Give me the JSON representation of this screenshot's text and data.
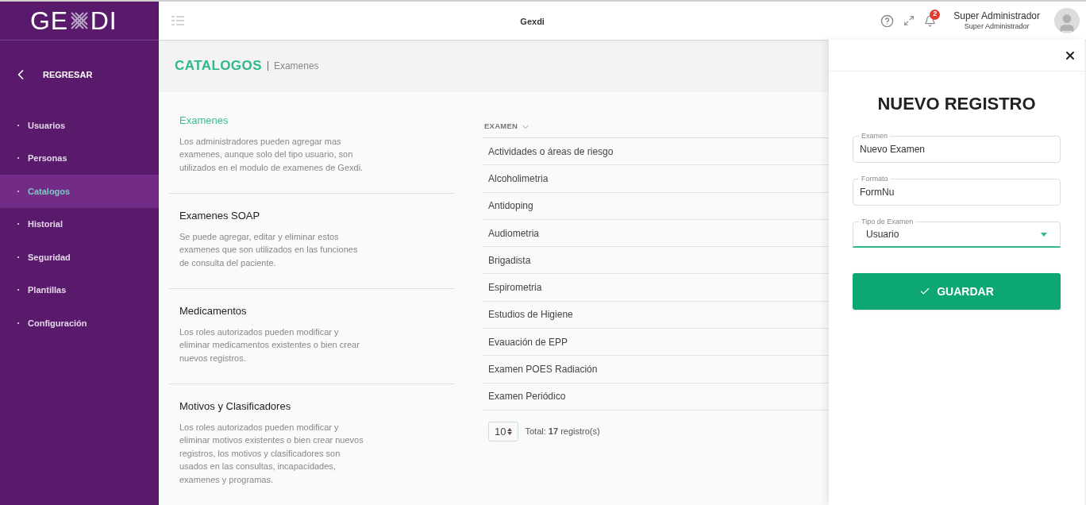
{
  "logo": {
    "left": "GE",
    "right": "DI"
  },
  "sidebar": {
    "back": "REGRESAR",
    "items": [
      {
        "label": "Usuarios",
        "selected": false
      },
      {
        "label": "Personas",
        "selected": false
      },
      {
        "label": "Catalogos",
        "selected": true
      },
      {
        "label": "Historial",
        "selected": false
      },
      {
        "label": "Seguridad",
        "selected": false
      },
      {
        "label": "Plantillas",
        "selected": false
      },
      {
        "label": "Configuración",
        "selected": false
      }
    ]
  },
  "header": {
    "title": "Gexdi",
    "notifications": "2",
    "user_name": "Super Administrador",
    "user_role": "Super Administrador"
  },
  "page": {
    "title": "CATALOGOS",
    "breadcrumb": "Examenes"
  },
  "catalogs": [
    {
      "title": "Examenes",
      "selected": true,
      "description": "Los administradores pueden agregar mas examenes, aunque solo del tipo usuario, son utilizados en el modulo de examenes de Gexdi."
    },
    {
      "title": "Examenes SOAP",
      "selected": false,
      "description": "Se puede agregar, editar y eliminar estos examenes que son utilizados en las funciones de consulta del paciente."
    },
    {
      "title": "Medicamentos",
      "selected": false,
      "description": "Los roles autorizados pueden modificar y eliminar medicamentos existentes o bien crear nuevos registros."
    },
    {
      "title": "Motivos y Clasificadores",
      "selected": false,
      "description": "Los roles autorizados pueden modificar y eliminar motivos existentes o bien crear nuevos registros, los motivos y clasificadores son usados en las consultas, incapacidades, examenes y programas."
    }
  ],
  "table": {
    "columns": [
      "EXAMEN"
    ],
    "rows": [
      "Actividades o áreas de riesgo",
      "Alcoholimetria",
      "Antidoping",
      "Audiometria",
      "Brigadista",
      "Espirometria",
      "Estudios de Higiene",
      "Evauación de EPP",
      "Examen POES Radiación",
      "Examen Periódico"
    ],
    "page_size": "10",
    "total": "Total:  **17** registro(s)"
  },
  "drawer": {
    "title": "NUEVO REGISTRO",
    "fields": [
      {
        "kind": "text",
        "label": "Examen",
        "value": "Nuevo Examen"
      },
      {
        "kind": "text",
        "label": "Formato",
        "value": "FormNu"
      },
      {
        "kind": "select",
        "label": "Tipo de Examen",
        "value": "Usuario"
      }
    ],
    "button": "GUARDAR"
  }
}
